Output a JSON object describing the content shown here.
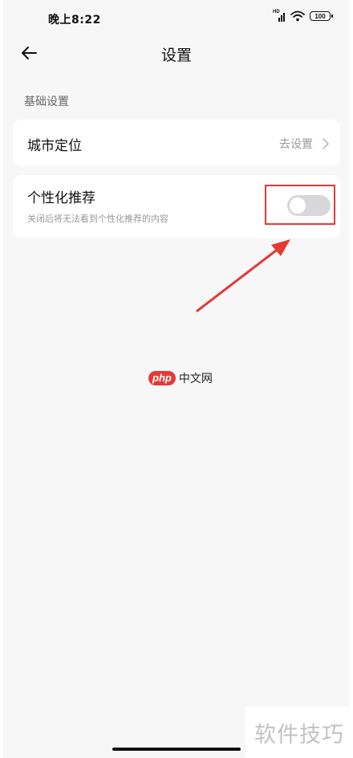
{
  "status_bar": {
    "time": "晚上8:22",
    "network": "HD",
    "battery": "100"
  },
  "header": {
    "back_icon": "arrow-left-icon",
    "title": "设置"
  },
  "section": {
    "title": "基础设置"
  },
  "city_location": {
    "label": "城市定位",
    "action": "去设置",
    "chevron_icon": "chevron-right-icon"
  },
  "personalized": {
    "label": "个性化推荐",
    "description": "关闭后将无法看到个性化推荐的内容",
    "toggle_on": false
  },
  "annotation": {
    "highlight_color": "#e53935"
  },
  "watermark": {
    "logo": "php",
    "text": "中文网"
  },
  "corner_watermark": "软件技巧"
}
